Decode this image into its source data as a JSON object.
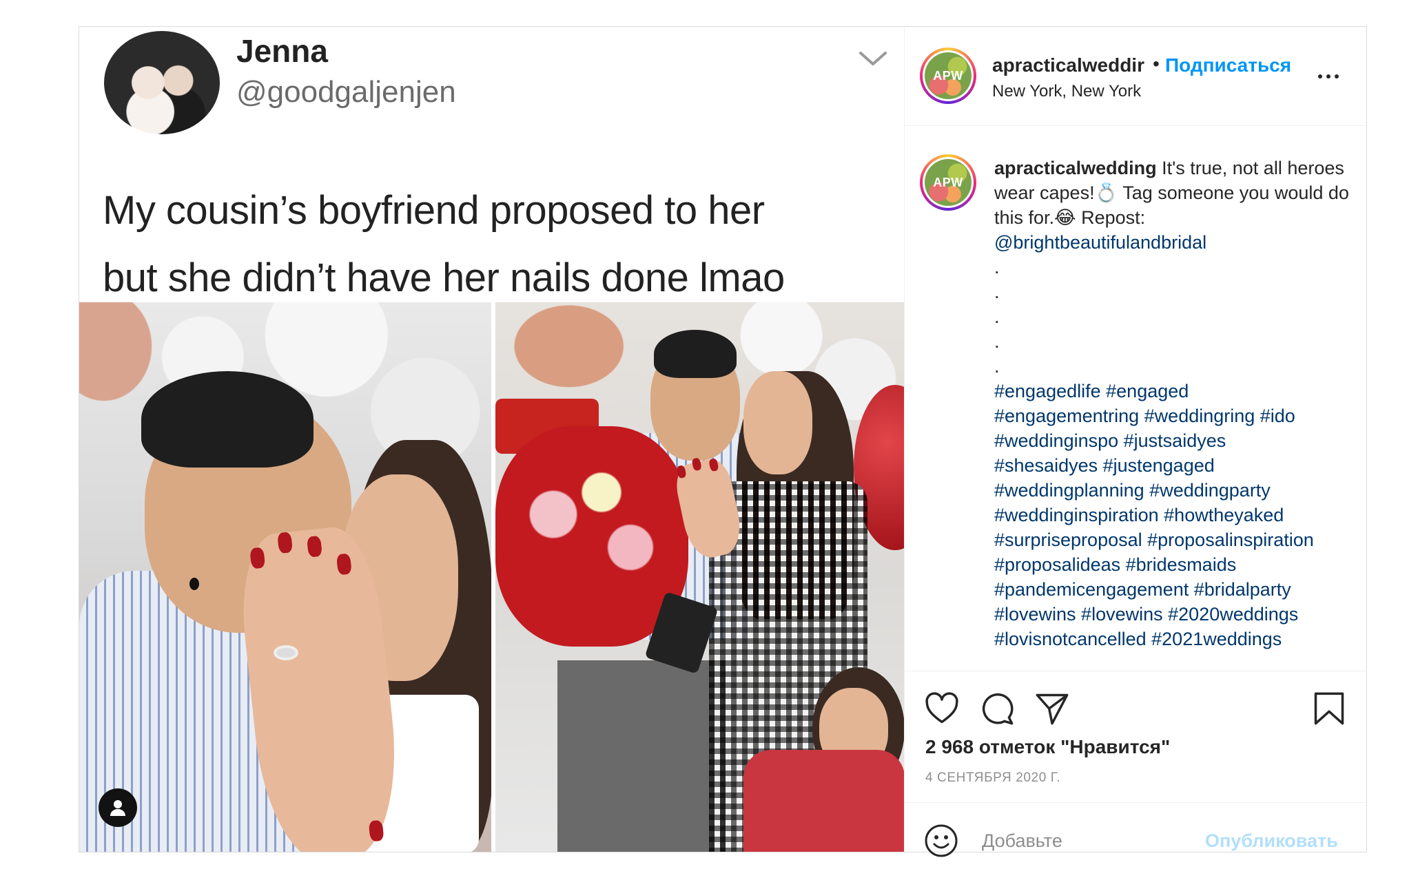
{
  "tweet": {
    "name": "Jenna",
    "handle": "@goodgaljenjen",
    "text_line1": "My cousin’s boyfriend proposed to her",
    "text_line2": "but she didn’t have her nails done lmao"
  },
  "header": {
    "username": "apracticalweddir",
    "separator": "•",
    "follow_label": "Подписаться",
    "location": "New York, New York",
    "avatar_text": "APW"
  },
  "caption": {
    "username": "apracticalwedding",
    "text": " It's true, not all heroes wear capes!💍 Tag someone you would do this for.😂 Repost:",
    "mention": "@brightbeautifulandbridal",
    "dots": [
      ".",
      ".",
      ".",
      ".",
      "."
    ],
    "hashtag_lines": [
      "#engagedlife #engaged",
      "#engagementring #weddingring #ido",
      "#weddinginspo #justsaidyes",
      "#shesaidyes #justengaged",
      "#weddingplanning #weddingparty",
      "#weddinginspiration #howtheyaked",
      "#surpriseproposal #proposalinspiration",
      "#proposalideas #bridesmaids",
      "#pandemicengagement #bridalparty",
      "#lovewins #lovewins #2020weddings",
      "#lovisnotcancelled #2021weddings"
    ]
  },
  "likes": "2 968 отметок \"Нравится\"",
  "date": "4 СЕНТЯБРЯ 2020 Г.",
  "comment": {
    "placeholder": "Добавьте",
    "publish_label": "Опубликовать"
  },
  "colors": {
    "link": "#00376b",
    "follow": "#0095f6",
    "publish_disabled": "#b2dffc",
    "muted": "#8e8e8e"
  },
  "icons": [
    "chevron-down-icon",
    "user-tag-icon",
    "more-icon",
    "heart-icon",
    "comment-icon",
    "share-icon",
    "bookmark-icon",
    "emoji-icon"
  ]
}
